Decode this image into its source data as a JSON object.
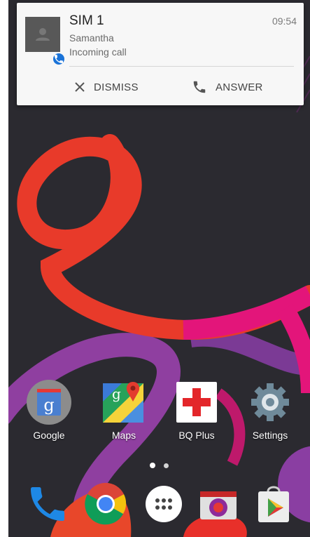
{
  "notification": {
    "title": "SIM 1",
    "time": "09:54",
    "caller": "Samantha",
    "status": "Incoming call",
    "actions": [
      {
        "label": "DISMISS",
        "icon": "close-icon"
      },
      {
        "label": "ANSWER",
        "icon": "phone-icon"
      }
    ]
  },
  "home": {
    "apps": [
      {
        "label": "Google",
        "icon": "google-search-icon"
      },
      {
        "label": "Maps",
        "icon": "maps-icon"
      },
      {
        "label": "BQ Plus",
        "icon": "bq-plus-icon"
      },
      {
        "label": "Settings",
        "icon": "settings-gear-icon"
      }
    ],
    "page_indicator": {
      "pages": 2,
      "current": 1
    },
    "dock": [
      {
        "icon": "phone-icon"
      },
      {
        "icon": "chrome-icon"
      },
      {
        "icon": "app-drawer-icon"
      },
      {
        "icon": "camera-icon"
      },
      {
        "icon": "play-store-icon"
      }
    ]
  },
  "colors": {
    "wallpaper_background": "#2b2a30",
    "swirl_red": "#e8302a",
    "swirl_pink": "#e3157a",
    "swirl_purple": "#8f3fa0",
    "notification_background": "#f7f7f7",
    "call_badge": "#1a73d8"
  }
}
